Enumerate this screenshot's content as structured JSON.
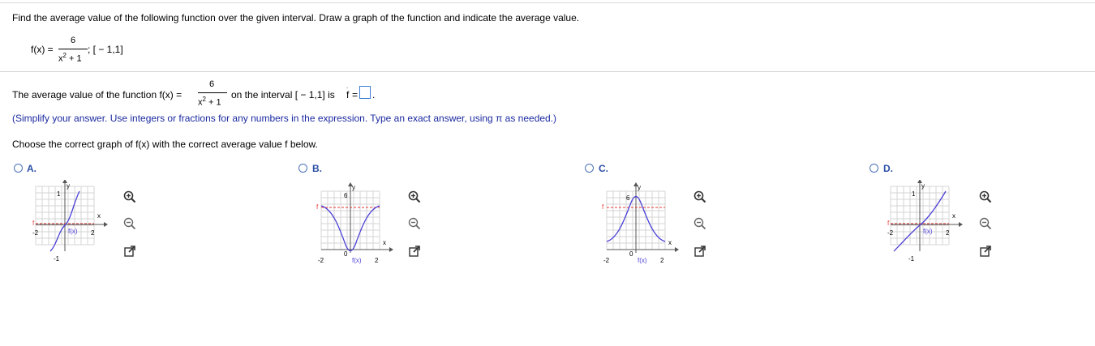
{
  "question": {
    "prompt": "Find the average value of the following function over the given interval. Draw a graph of the function and indicate the average value.",
    "fx_label": "f(x) =",
    "numerator": "6",
    "denominator_x": "x",
    "denominator_exp": "2",
    "denominator_rest": "+ 1",
    "interval": "; [ − 1,1]"
  },
  "answer": {
    "lead": "The average value of the function f(x) =",
    "numerator": "6",
    "den_x": "x",
    "den_exp": "2",
    "den_rest": "+ 1",
    "middle": "on the interval [ − 1,1] is",
    "fbar": "f",
    "equals": "=",
    "value": "",
    "period": "."
  },
  "instructions": "(Simplify your answer. Use integers or fractions for any numbers in the expression. Type an exact answer, using π as needed.)",
  "choose": "Choose the correct graph of f(x) with the correct average value f below.",
  "options": [
    {
      "letter": "A.",
      "ymax": "1",
      "ymin": "-1",
      "xmin": "-2",
      "xmax": "2",
      "xlabel": "x",
      "ylabel": "y",
      "fbar": "f",
      "curve": "f(x)"
    },
    {
      "letter": "B.",
      "ymax": "6",
      "ymin": "0",
      "xmin": "-2",
      "xmax": "2",
      "xlabel": "x",
      "ylabel": "y",
      "fbar": "f",
      "curve": "f(x)"
    },
    {
      "letter": "C.",
      "ymax": "6",
      "ymin": "0",
      "xmin": "-2",
      "xmax": "2",
      "xlabel": "x",
      "ylabel": "y",
      "fbar": "f",
      "curve": "f(x)"
    },
    {
      "letter": "D.",
      "ymax": "1",
      "ymin": "-1",
      "xmin": "-2",
      "xmax": "2",
      "xlabel": "x",
      "ylabel": "y",
      "fbar": "f",
      "curve": "f(x)"
    }
  ],
  "colors": {
    "curve": "#4a3fd6",
    "avg": "#e53935",
    "link": "#2b4fa6"
  },
  "icons": [
    "zoom-in-icon",
    "zoom-out-icon",
    "open-external-icon"
  ]
}
